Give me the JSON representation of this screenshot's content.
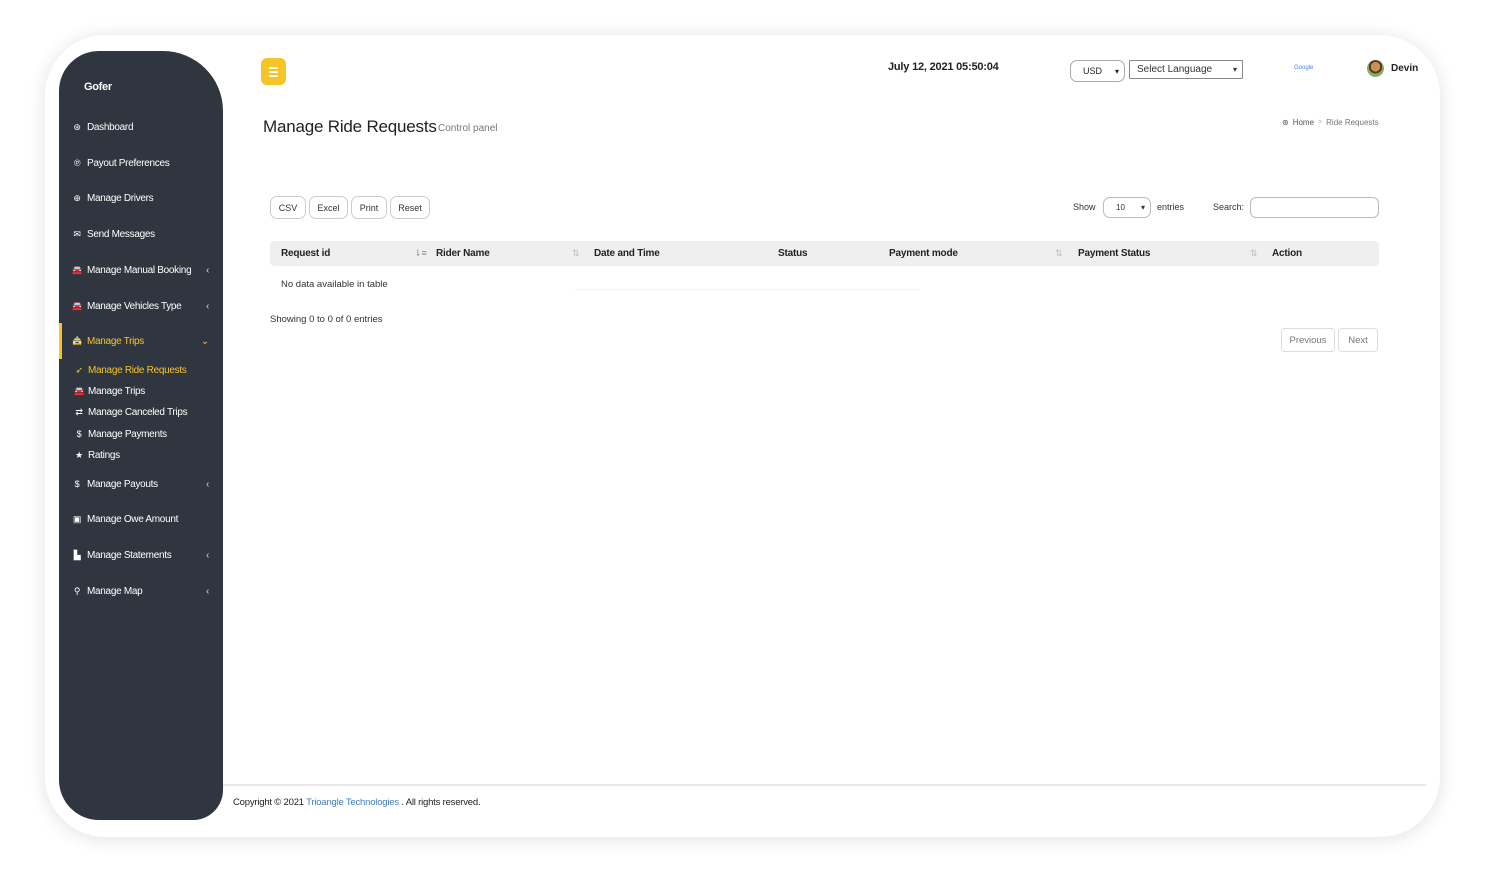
{
  "app": {
    "brand": "Gofer"
  },
  "sidebar": {
    "items": [
      {
        "label": "Dashboard",
        "icon": "dashboard-icon",
        "glyph": "⊛",
        "chevron": ""
      },
      {
        "label": "Payout Preferences",
        "icon": "paypal-icon",
        "glyph": "℗",
        "chevron": ""
      },
      {
        "label": "Manage Drivers",
        "icon": "steering-wheel-icon",
        "glyph": "⊕",
        "chevron": ""
      },
      {
        "label": "Send Messages",
        "icon": "megaphone-icon",
        "glyph": "✉",
        "chevron": ""
      },
      {
        "label": "Manage Manual Booking",
        "icon": "car-icon",
        "glyph": "🚘",
        "chevron": "‹"
      },
      {
        "label": "Manage Vehicles Type",
        "icon": "car-icon",
        "glyph": "🚘",
        "chevron": "‹"
      },
      {
        "label": "Manage Trips",
        "icon": "taxi-icon",
        "glyph": "🚖",
        "chevron": "⌄"
      },
      {
        "label": "Manage Payouts",
        "icon": "dollar-icon",
        "glyph": "$",
        "chevron": "‹"
      },
      {
        "label": "Manage Owe Amount",
        "icon": "money-bill-icon",
        "glyph": "▣",
        "chevron": ""
      },
      {
        "label": "Manage Statements",
        "icon": "area-chart-icon",
        "glyph": "▙",
        "chevron": "‹"
      },
      {
        "label": "Manage Map",
        "icon": "map-marker-icon",
        "glyph": "⚲",
        "chevron": "‹"
      }
    ],
    "subitems": [
      {
        "label": "Manage Ride Requests",
        "icon": "paper-plane-icon",
        "glyph": "➶"
      },
      {
        "label": "Manage Trips",
        "icon": "car-icon",
        "glyph": "🚘"
      },
      {
        "label": "Manage Canceled Trips",
        "icon": "canceled-money-icon",
        "glyph": "⇄"
      },
      {
        "label": "Manage Payments",
        "icon": "dollar-icon",
        "glyph": "$"
      },
      {
        "label": "Ratings",
        "icon": "star-icon",
        "glyph": "★"
      }
    ],
    "active_item": "Manage Trips",
    "active_subitem": "Manage Ride Requests"
  },
  "header": {
    "datetime": "July 12, 2021 05:50:04",
    "currency": "USD",
    "language": "Select Language",
    "google_label": "Google",
    "user": "Devin"
  },
  "page": {
    "title": "Manage Ride Requests",
    "subtitle": "Control panel",
    "breadcrumb": {
      "home": "Home",
      "separator": ">",
      "current": "Ride Requests"
    }
  },
  "toolbar": {
    "buttons": [
      "CSV",
      "Excel",
      "Print",
      "Reset"
    ],
    "show_label": "Show",
    "page_size": "10",
    "entries_label": "entries",
    "search_label": "Search:",
    "search_value": ""
  },
  "table": {
    "columns": [
      "Request id",
      "Rider Name",
      "Date and Time",
      "Status",
      "Payment mode",
      "Payment Status",
      "Action"
    ],
    "rows": [],
    "empty_text": "No data available in table",
    "info": "Showing 0 to 0 of 0 entries"
  },
  "pagination": {
    "previous": "Previous",
    "next": "Next"
  },
  "footer": {
    "prefix": "Copyright © 2021",
    "company": "Trioangle Technologies",
    "suffix": ". All rights reserved."
  },
  "colors": {
    "accent": "#f5c527",
    "sidebar_bg": "#2f363f",
    "link": "#3c7dc4"
  }
}
